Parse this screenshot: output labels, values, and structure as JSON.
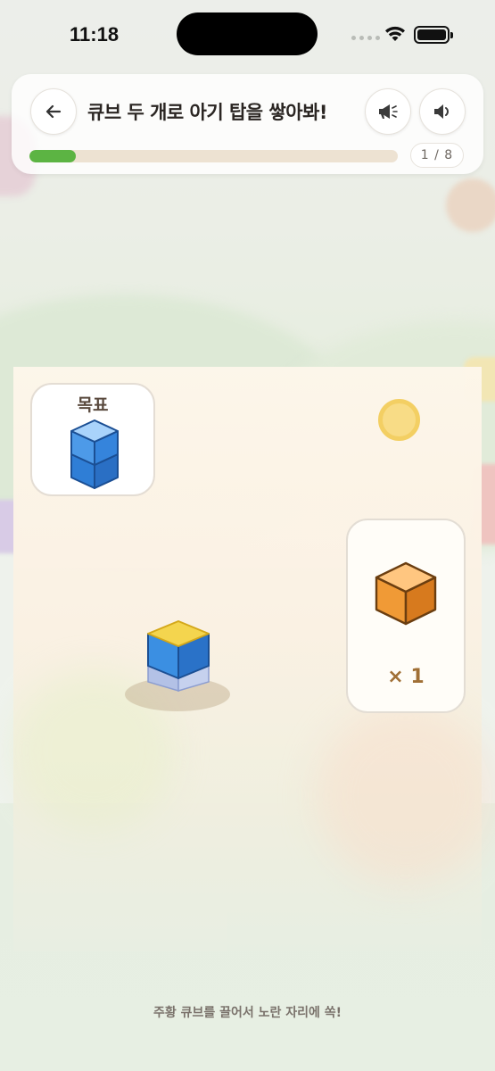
{
  "status_bar": {
    "time": "11:18"
  },
  "header": {
    "title": "큐브 두 개로 아기 탑을 쌓아봐!",
    "progress_fraction": 0.125,
    "counter": "1 / 8",
    "back_icon": "arrow-left-icon",
    "speak_icon": "megaphone-icon",
    "sound_icon": "speaker-icon"
  },
  "goal": {
    "label": "목표",
    "cube_color": "#3b86dc"
  },
  "tray": {
    "quantity": "× 1",
    "cube_color": "#f0a03c"
  },
  "board": {
    "placed_cube_color": "#3b86dc",
    "target_color": "#f4d54e"
  },
  "hint": "주황 큐브를 끌어서 노란 자리에 쏙!"
}
